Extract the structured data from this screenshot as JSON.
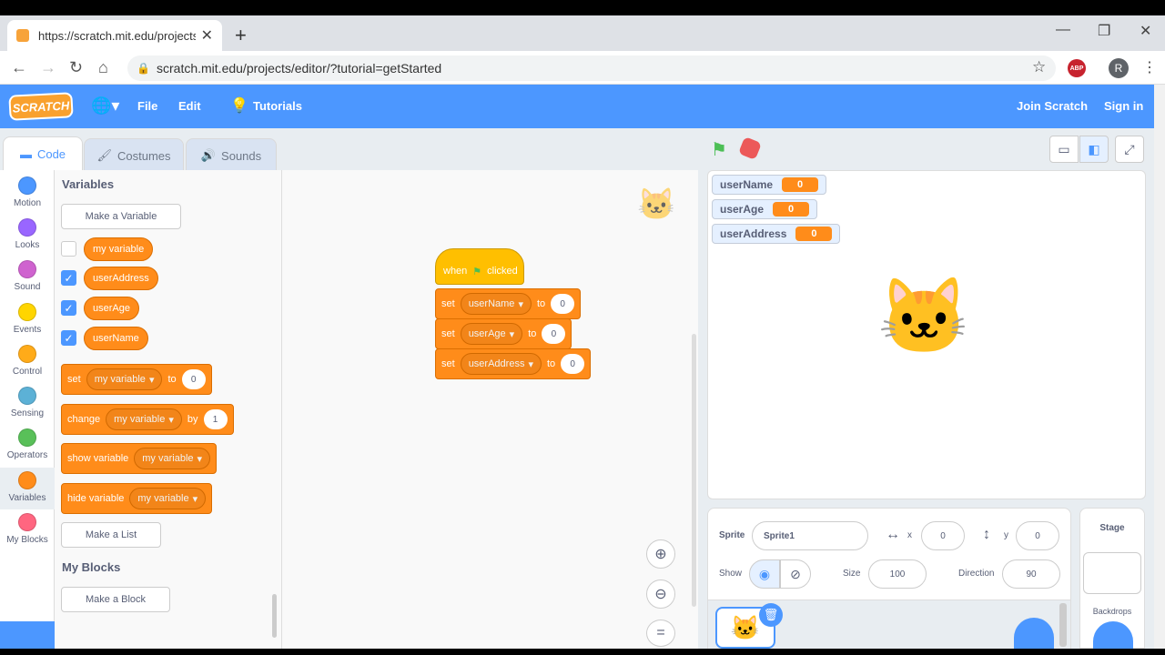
{
  "browser": {
    "tab_title": "https://scratch.mit.edu/projects/e",
    "url": "scratch.mit.edu/projects/editor/?tutorial=getStarted",
    "profile_initial": "R",
    "abp": "ABP"
  },
  "menu": {
    "logo": "SCRATCH",
    "file": "File",
    "edit": "Edit",
    "tutorials": "Tutorials",
    "join": "Join Scratch",
    "signin": "Sign in"
  },
  "tabs": {
    "code": "Code",
    "costumes": "Costumes",
    "sounds": "Sounds"
  },
  "categories": [
    {
      "label": "Motion",
      "color": "#4c97ff"
    },
    {
      "label": "Looks",
      "color": "#9966ff"
    },
    {
      "label": "Sound",
      "color": "#cf63cf"
    },
    {
      "label": "Events",
      "color": "#ffd500"
    },
    {
      "label": "Control",
      "color": "#ffab19"
    },
    {
      "label": "Sensing",
      "color": "#5cb1d6"
    },
    {
      "label": "Operators",
      "color": "#59c059"
    },
    {
      "label": "Variables",
      "color": "#ff8c1a"
    },
    {
      "label": "My Blocks",
      "color": "#ff6680"
    }
  ],
  "palette": {
    "variables_heading": "Variables",
    "make_variable": "Make a Variable",
    "vars": [
      "my variable",
      "userAddress",
      "userAge",
      "userName"
    ],
    "set": {
      "kw": "set",
      "var": "my variable",
      "to": "to",
      "val": "0"
    },
    "change": {
      "kw": "change",
      "var": "my variable",
      "by": "by",
      "val": "1"
    },
    "show": {
      "kw": "show variable",
      "var": "my variable"
    },
    "hide": {
      "kw": "hide variable",
      "var": "my variable"
    },
    "make_list": "Make a List",
    "myblocks_heading": "My Blocks",
    "make_block": "Make a Block"
  },
  "script": {
    "hat": {
      "when": "when",
      "clicked": "clicked"
    },
    "rows": [
      {
        "kw": "set",
        "var": "userName",
        "to": "to",
        "val": "0"
      },
      {
        "kw": "set",
        "var": "userAge",
        "to": "to",
        "val": "0"
      },
      {
        "kw": "set",
        "var": "userAddress",
        "to": "to",
        "val": "0"
      }
    ]
  },
  "monitors": [
    {
      "name": "userName",
      "value": "0"
    },
    {
      "name": "userAge",
      "value": "0"
    },
    {
      "name": "userAddress",
      "value": "0"
    }
  ],
  "sprite": {
    "label": "Sprite",
    "name": "Sprite1",
    "x_label": "x",
    "x": "0",
    "y_label": "y",
    "y": "0",
    "show": "Show",
    "size_label": "Size",
    "size": "100",
    "dir_label": "Direction",
    "dir": "90"
  },
  "stage_panel": {
    "title": "Stage",
    "backdrops": "Backdrops"
  }
}
